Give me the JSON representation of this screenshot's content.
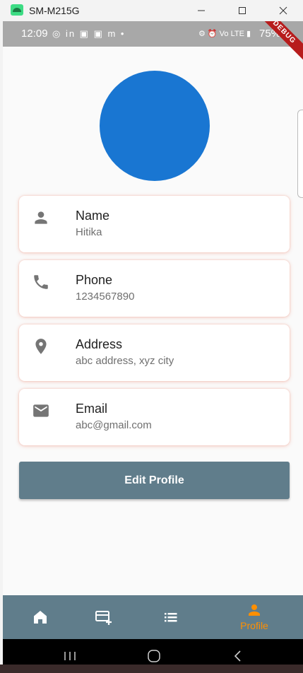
{
  "window": {
    "title": "SM-M215G",
    "minimize": "—",
    "maximize": "☐",
    "close": "✕"
  },
  "status_bar": {
    "time": "12:09",
    "notif_icons": "◎ in ▣ ▣ m •",
    "right_icons": "⚙ ⏰ Vo LTE ▮",
    "battery": "75%",
    "debug_banner": "DEBUG"
  },
  "profile": {
    "avatar_color": "#1976d2",
    "fields": [
      {
        "icon": "person-icon",
        "label": "Name",
        "value": "Hitika"
      },
      {
        "icon": "phone-icon",
        "label": "Phone",
        "value": "1234567890"
      },
      {
        "icon": "location-pin-icon",
        "label": "Address",
        "value": "abc address, xyz city"
      },
      {
        "icon": "email-icon",
        "label": "Email",
        "value": "abc@gmail.com"
      }
    ],
    "edit_button_label": "Edit Profile"
  },
  "bottom_nav": {
    "items": [
      {
        "icon": "home-icon",
        "label": ""
      },
      {
        "icon": "add-card-icon",
        "label": ""
      },
      {
        "icon": "list-icon",
        "label": ""
      },
      {
        "icon": "profile-icon",
        "label": "Profile",
        "active": true
      }
    ],
    "background": "#607d8b",
    "active_color": "#ff8f00"
  }
}
